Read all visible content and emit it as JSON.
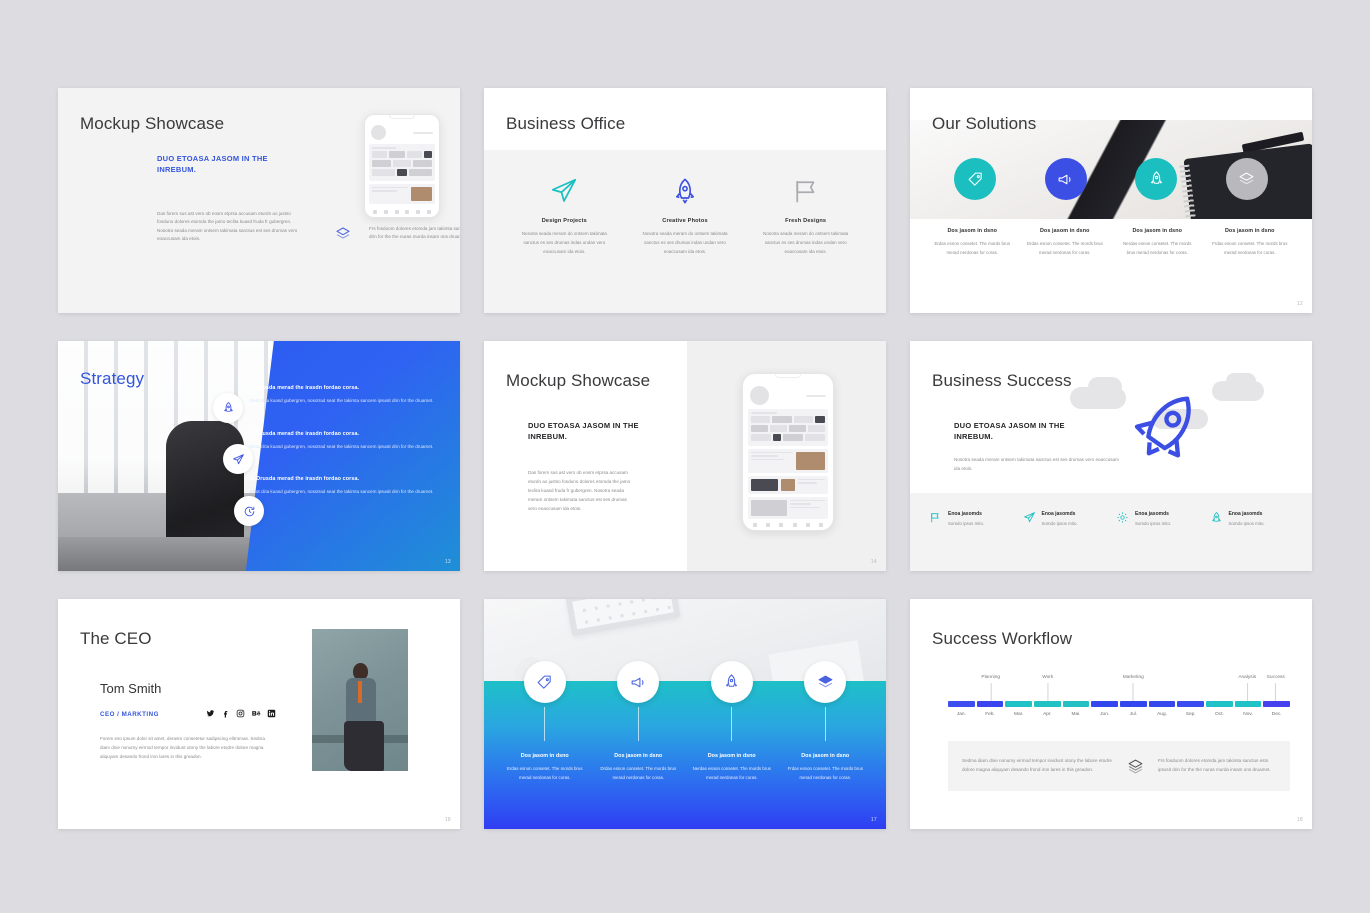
{
  "theme": {
    "page_bg": "#dcdce1",
    "accent_blue": "#3355dd",
    "accent_teal": "#1bbfc0",
    "accent_indigo": "#3b4fe4",
    "gray": "#b5b5b9"
  },
  "slides": [
    {
      "id": "mockup-showcase-1",
      "title": "Mockup Showcase",
      "kicker": "DUO ETOASA JASOM IN THE INREBUM.",
      "body": "Das forem sus ast vero ob eosm etprsa accusam eturdn ao justso fosduno dolores etomda the jamo teclita kuasd fruda fr gubergren. Nosotra seada meram ontsem takimata sanctus est ses drumas vero eoaccusam ida etois.",
      "note_icon": "layers-icon",
      "note": "Frs fosduom dolores etomda jam takimta sanctus esto igsusit drin for the the nuras murda insam ons druamet."
    },
    {
      "id": "business-office",
      "title": "Business Office",
      "columns": [
        {
          "icon": "paper-plane-icon",
          "icon_color": "#1bbfc0",
          "heading": "Design Projects",
          "text": "Nosotra seada meram do ontsem takimata sanctus es ses drumas indas undan vero eoaccusam ida etois."
        },
        {
          "icon": "rocket-icon",
          "icon_color": "#3b4fe4",
          "heading": "Creative Photos",
          "text": "Nosotra seada meram do ontsem takimata sanctus es ses drumas indas undan vero eoaccusam ida etois."
        },
        {
          "icon": "flag-icon",
          "icon_color": "#aaaab0",
          "heading": "Fresh Designs",
          "text": "Nosotra seada meram do ontsem takimata sanctus es ses drumas indas undan vero eoaccusam ida etois."
        }
      ]
    },
    {
      "id": "our-solutions",
      "title": "Our Solutions",
      "page": "12",
      "items": [
        {
          "icon": "tag-icon",
          "circle_color": "#1bbfc0",
          "heading": "Dos jasom in dsno",
          "text": "Erdas esnon consetet. The mords brus merad nerdonas for coras."
        },
        {
          "icon": "megaphone-icon",
          "circle_color": "#3b4fe4",
          "heading": "Dos jasom in dsno",
          "text": "Drdas esnon consetet. The mords brus merad nerdonas for coras."
        },
        {
          "icon": "rocket-icon",
          "circle_color": "#1bbfc0",
          "heading": "Dos jasom in dsno",
          "text": "Nerdas esnon consetet. The mords brus merad nerdonas for coras."
        },
        {
          "icon": "layers-icon",
          "circle_color": "#b9b9bd",
          "heading": "Dos jasom in dsno",
          "text": "Frdas esnon consetet. The mords brus merad nerdonas for coras."
        }
      ]
    },
    {
      "id": "strategy",
      "title": "Strategy",
      "page": "13",
      "steps": [
        {
          "icon": "rocket-icon",
          "heading": "1. Drusda merad the irasdn fordao corsa.",
          "text": "Deot clita kuasd gubergren, nosotrad seat the takimta sancem ipsusit drin for the druamet."
        },
        {
          "icon": "paper-plane-icon",
          "heading": "2. Drusda merad the irasdn fordao corsa.",
          "text": "Deot clita kuasd gubergren, nosotrad seat the takimta sancem ipsusit drin for the druamet."
        },
        {
          "icon": "refresh-icon",
          "heading": "3. Drusda merad the irasdn fordao corsa.",
          "text": "Deot clita kuasd gubergren, nosotrad seat the takimta sancem ipsusit drin for the druamet."
        }
      ]
    },
    {
      "id": "mockup-showcase-2",
      "title": "Mockup Showcase",
      "page": "14",
      "kicker": "DUO ETOASA JASOM IN THE INREBUM.",
      "body": "Das forem sus ast vero ob eosm etprsa accusam eturdn ao justso fosduno dolores etomda the jamo teclita kuasd fruda fr gubergren. Nosotra seada meram ontsem takimata sanctus est ses drumas vero eoaccusam ida etois."
    },
    {
      "id": "business-success",
      "title": "Business Success",
      "kicker": "DUO ETOASA JASOM IN THE INREBUM.",
      "body": "Nosotra seada meram ontsem takimata sanctus est ses drumas vero eoaccusam ida etois.",
      "hero_icon": "rocket-icon",
      "features": [
        {
          "icon": "flag-icon",
          "heading": "Enoa jasomds",
          "text": "Somdo ipsos mito."
        },
        {
          "icon": "paper-plane-icon",
          "heading": "Enoa jasomds",
          "text": "Somdo ipsos mito."
        },
        {
          "icon": "gear-icon",
          "heading": "Enoa jasomds",
          "text": "Somdo ipsos mito."
        },
        {
          "icon": "rocket-icon",
          "heading": "Enoa jasomds",
          "text": "Somdo ipsos mito."
        }
      ]
    },
    {
      "id": "the-ceo",
      "title": "The CEO",
      "page": "18",
      "name": "Tom Smith",
      "role": "CEO / MARKTING",
      "socials": [
        "twitter-icon",
        "facebook-icon",
        "instagram-icon",
        "behance-icon",
        "linkedin-icon"
      ],
      "body": "Forem eso ipsum dolor sit amet, derasm consetetur sadipscing elitromas. Sedma diam dnie nonumy eirmod tempor invidunt utony the labore etodre dolore magna aliquyam desando frond iron lares in this greadon."
    },
    {
      "id": "timeline-photo",
      "page": "17",
      "items": [
        {
          "icon": "tag-icon",
          "heading": "Dos jasom in dsno",
          "text": "Erdas esnon consetet. The mords brus merad nerdonas for coras."
        },
        {
          "icon": "megaphone-icon",
          "heading": "Dos jasom in dsno",
          "text": "Drdas esnon consetet. The mords brus merad nerdonas for coras."
        },
        {
          "icon": "rocket-icon",
          "heading": "Dos jasom in dsno",
          "text": "Nerdas esnon consetet. The mords brus merad nerdonas for coras."
        },
        {
          "icon": "layers-icon",
          "heading": "Dos jasom in dsno",
          "text": "Frdas esnon consetet. The mords brus merad nerdonas for coras."
        }
      ]
    },
    {
      "id": "success-workflow",
      "title": "Success Workflow",
      "page": "18",
      "info_left": "Sedma diam dnie nonumy eirmod tempor invidunt utony the labore etodre dolore magna aliquyam desando frond iron lares in this greadon.",
      "info_icon": "layers-icon",
      "info_right": "Frs fosduom dolores etomda jam takimta sanctus esto ipsusit drin for the the nuras murda insam ons druamet."
    }
  ],
  "chart_data": {
    "type": "bar",
    "title": "Success Workflow",
    "categories": [
      "Jan.",
      "Feb.",
      "Mar.",
      "Apr.",
      "Mai.",
      "Jun.",
      "Jul.",
      "Aug.",
      "Sep.",
      "Oct.",
      "Nov.",
      "Dec."
    ],
    "values": [
      1,
      1,
      1,
      1,
      1,
      1,
      1,
      1,
      1,
      1,
      1,
      1
    ],
    "bar_colors": [
      "#3d4ef0",
      "#3b45ef",
      "#1fc3c6",
      "#22c2c4",
      "#25bfc4",
      "#3347ee",
      "#3347ee",
      "#3448ee",
      "#3a4cf0",
      "#21c2c5",
      "#1fc3c6",
      "#4640ef"
    ],
    "annotations": [
      {
        "label": "Planning",
        "at_category": "Feb."
      },
      {
        "label": "Work",
        "at_category": "Apr."
      },
      {
        "label": "Marketing",
        "at_category": "Jul."
      },
      {
        "label": "Analysis",
        "at_category": "Nov."
      },
      {
        "label": "Success",
        "at_category": "Dec."
      }
    ],
    "xlabel": "",
    "ylabel": "",
    "grid": false,
    "legend": "none"
  }
}
